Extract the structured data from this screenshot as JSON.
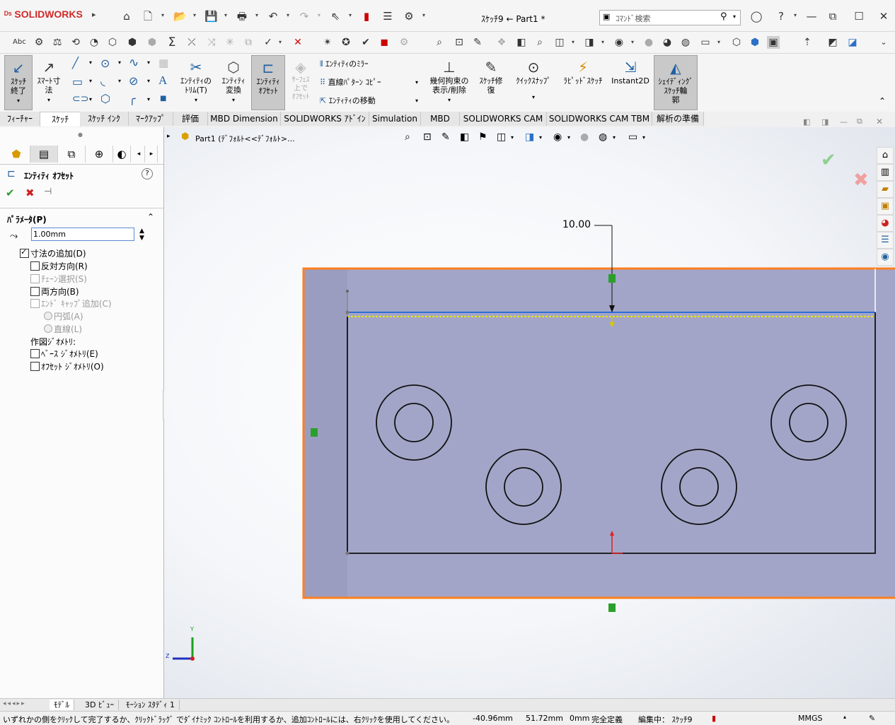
{
  "app": {
    "logo": "SOLIDWORKS",
    "doc_title": "ｽｹｯﾁ9 ← Part1 *"
  },
  "search": {
    "placeholder": "ｺﾏﾝﾄﾞ検索"
  },
  "window": {
    "minimize": "—",
    "maximize": "☐",
    "close": "✕",
    "restore": "⧉"
  },
  "commands": {
    "sketch_exit": "ｽｹｯﾁ\n終了",
    "smart_dim": "ｽﾏｰﾄ寸\n法",
    "trim": "ｴﾝﾃｨﾃｨの\nﾄﾘﾑ(T)",
    "convert": "ｴﾝﾃｨﾃｨ\n変換",
    "offset": "ｴﾝﾃｨﾃｨ\nｵﾌｾｯﾄ",
    "surface_offset": "ｻｰﾌｪｽ\n上で\nｵﾌｾｯﾄ",
    "mirror": "ｴﾝﾃｨﾃｨのﾐﾗｰ",
    "linear_pattern": "直線ﾊﾟﾀｰﾝ ｺﾋﾟｰ",
    "move": "ｴﾝﾃｨﾃｨの移動",
    "relations": "幾何拘束の\n表示/削除",
    "repair": "ｽｹｯﾁ修\n復",
    "quick_snap": "ｸｲｯｸｽﾅｯﾌﾟ",
    "rapid_sketch": "ﾗﾋﾟｯﾄﾞｽｹｯﾁ",
    "instant2d": "Instant2D",
    "shaded": "ｼｪｲﾃﾞｨﾝｸﾞ\nｽｹｯﾁ輪\n郭"
  },
  "tabs": [
    "ﾌｨｰﾁｬｰ",
    "ｽｹｯﾁ",
    "ｽｹｯﾁ ｲﾝｸ",
    "ﾏｰｸｱｯﾌﾟ",
    "評価",
    "MBD Dimension",
    "SOLIDWORKS ｱﾄﾞｲﾝ",
    "Simulation",
    "MBD",
    "SOLIDWORKS CAM",
    "SOLIDWORKS CAM TBM",
    "解析の準備"
  ],
  "panel": {
    "title": "ｴﾝﾃｨﾃｨ ｵﾌｾｯﾄ",
    "section": "ﾊﾟﾗﾒｰﾀ(P)",
    "distance": "1.00mm",
    "add_dims": "寸法の追加(D)",
    "reverse": "反対方向(R)",
    "chain": "ﾁｪｰﾝ選択(S)",
    "bidirectional": "両方向(B)",
    "endcaps": "ｴﾝﾄﾞ ｷｬｯﾌﾟ追加(C)",
    "arc": "円弧(A)",
    "line": "直線(L)",
    "construction": "作図ｼﾞｵﾒﾄﾘ:",
    "base_geom": "ﾍﾞｰｽ ｼﾞｵﾒﾄﾘ(E)",
    "offset_geom": "ｵﾌｾｯﾄ ｼﾞｵﾒﾄﾘ(O)"
  },
  "tree": {
    "label": "Part1 (ﾃﾞﾌｫﾙﾄ<<ﾃﾞﾌｫﾙﾄ>..."
  },
  "dimension": {
    "value": "10.00"
  },
  "triad": {
    "y": "Y",
    "z": "Z"
  },
  "bottom_tabs": [
    "ﾓﾃﾞﾙ",
    "3D ﾋﾞｭｰ",
    "ﾓｰｼｮﾝ ｽﾀﾃﾞｨ 1"
  ],
  "status": {
    "message": "いずれかの側をｸﾘｯｸして完了するか、ｸﾘｯｸﾄﾞﾗｯｸﾞ でﾀﾞｲﾅﾐｯｸ ｺﾝﾄﾛｰﾙを利用するか、追加ｺﾝﾄﾛｰﾙには、右ｸﾘｯｸを使用してください。",
    "x": "-40.96mm",
    "y": "51.72mm",
    "z": "0mm",
    "state": "完全定義",
    "editing": "編集中： ｽｹｯﾁ9",
    "units": "MMGS"
  },
  "colors": {
    "accent_orange": "#ff7f1e",
    "part_fill": "#a3a5c8",
    "offset_yellow": "#e8e800",
    "sketch_blue": "#2f6ed8"
  }
}
